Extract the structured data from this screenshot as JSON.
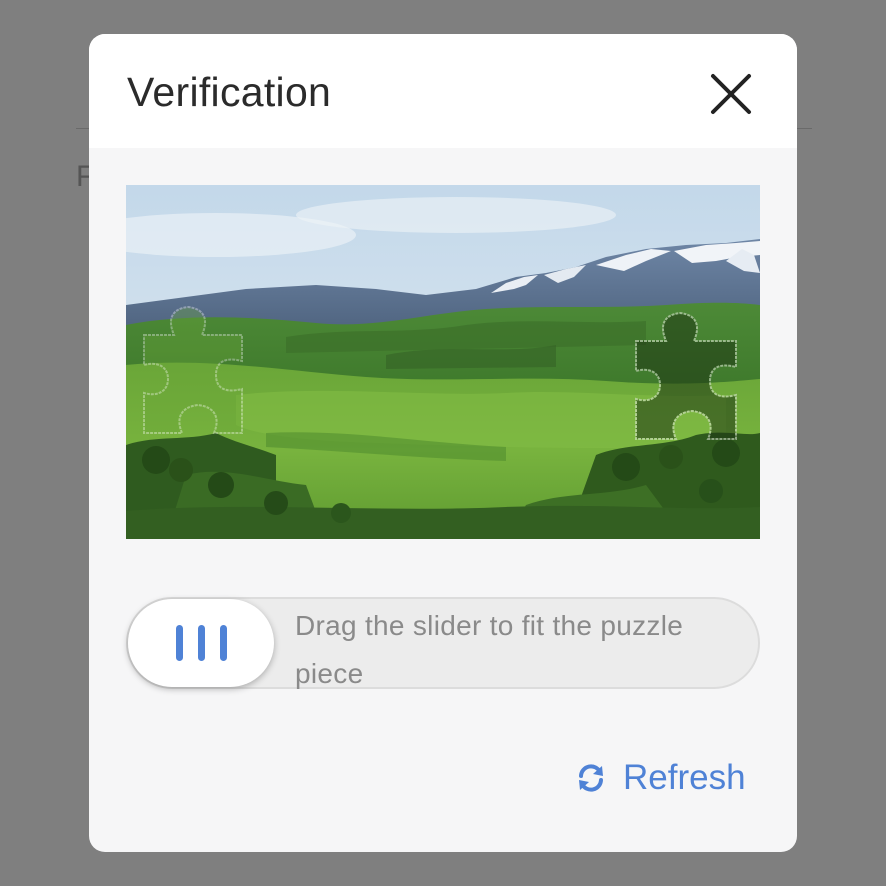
{
  "background": {
    "partial_text": "F"
  },
  "modal": {
    "title": "Verification",
    "close_icon": "close-icon"
  },
  "puzzle": {
    "image_description": "mountain meadow landscape with puzzle piece cutout"
  },
  "slider": {
    "hint": "Drag the slider to fit the puzzle piece",
    "handle_icon": "grip-lines-icon"
  },
  "refresh": {
    "label": "Refresh",
    "icon": "refresh-icon"
  },
  "colors": {
    "accent": "#4f82d6",
    "backdrop": "#7f7f7f",
    "modal_bg": "#f6f6f7",
    "title_text": "#2b2b2b",
    "hint_text": "#8a8a8a"
  }
}
